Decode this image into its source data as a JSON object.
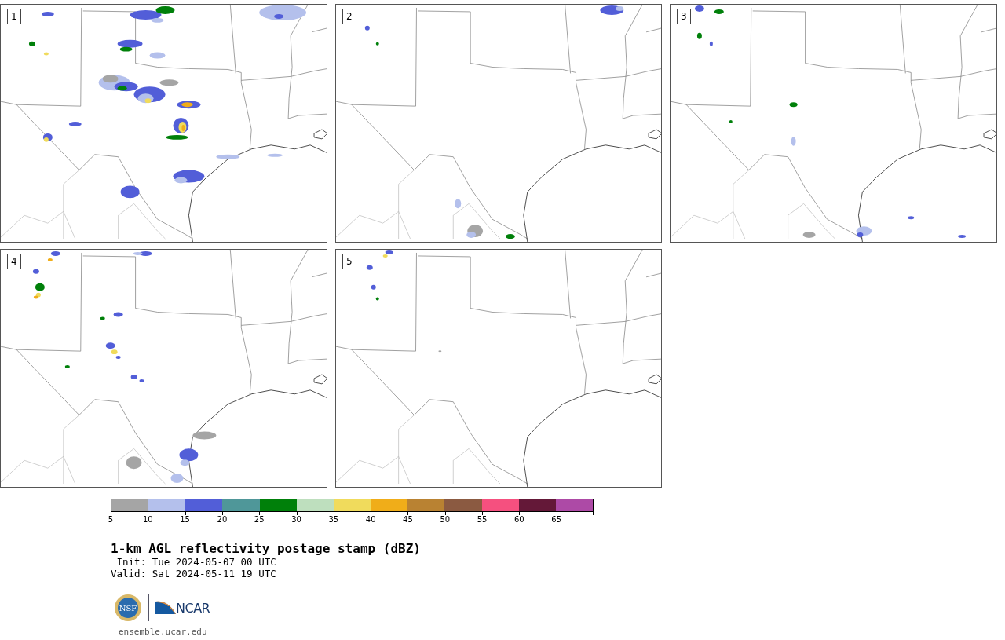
{
  "panels": [
    {
      "label": "1"
    },
    {
      "label": "2"
    },
    {
      "label": "3"
    },
    {
      "label": "4"
    },
    {
      "label": "5"
    }
  ],
  "colorbar": {
    "bins": [
      {
        "color": "#a5a5a5"
      },
      {
        "color": "#b4c0ec"
      },
      {
        "color": "#525ed8"
      },
      {
        "color": "#4f9799"
      },
      {
        "color": "#00800a"
      },
      {
        "color": "#bedfbe"
      },
      {
        "color": "#f0db5c"
      },
      {
        "color": "#f0ad19"
      },
      {
        "color": "#b98232"
      },
      {
        "color": "#8b5a41"
      },
      {
        "color": "#f5507f"
      },
      {
        "color": "#641838"
      },
      {
        "color": "#ad4aa6"
      }
    ],
    "ticks": [
      "5",
      "10",
      "15",
      "20",
      "25",
      "30",
      "35",
      "40",
      "45",
      "50",
      "55",
      "60",
      "65"
    ]
  },
  "title": "1-km AGL reflectivity postage stamp (dBZ)",
  "init": " Init: Tue 2024-05-07 00 UTC",
  "valid": "Valid: Sat 2024-05-11 19 UTC",
  "logos": {
    "nsf": "NSF",
    "ncar": "NCAR"
  },
  "url": "ensemble.ucar.edu"
}
